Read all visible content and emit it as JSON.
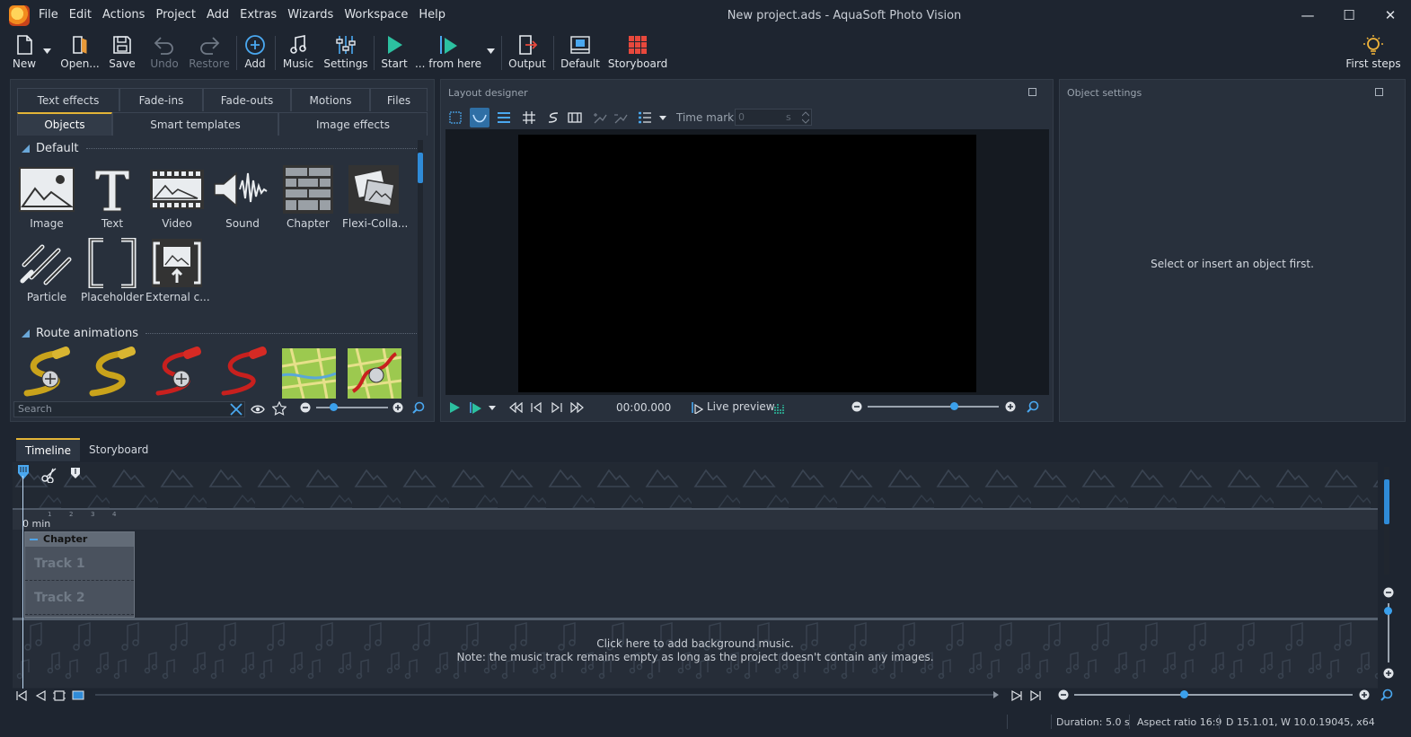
{
  "window": {
    "title": "New project.ads - AquaSoft Photo Vision",
    "minimize": "—",
    "maximize": "☐",
    "close": "✕"
  },
  "menu": [
    "File",
    "Edit",
    "Actions",
    "Project",
    "Add",
    "Extras",
    "Wizards",
    "Workspace",
    "Help"
  ],
  "toolbar": {
    "new": "New",
    "open": "Open...",
    "save": "Save",
    "undo": "Undo",
    "restore": "Restore",
    "add": "Add",
    "music": "Music",
    "settings": "Settings",
    "start": "Start",
    "from_here": "... from here",
    "output": "Output",
    "default": "Default",
    "storyboard": "Storyboard",
    "first_steps": "First steps"
  },
  "toolbox": {
    "tabs_row1": [
      "Text effects",
      "Fade-ins",
      "Fade-outs",
      "Motions",
      "Files"
    ],
    "tabs_row2": [
      "Objects",
      "Smart templates",
      "Image effects"
    ],
    "section_default": "Default",
    "objects": [
      "Image",
      "Text",
      "Video",
      "Sound",
      "Chapter",
      "Flexi-Colla...",
      "Particle",
      "Placeholder",
      "External c..."
    ],
    "section_routes": "Route animations",
    "search_placeholder": "Search"
  },
  "layout_designer": {
    "title": "Layout designer",
    "time_mark_label": "Time mark:",
    "time_mark_value": "0",
    "time_mark_unit": "s",
    "time_display": "00:00.000",
    "live_preview": "Live preview"
  },
  "object_settings": {
    "title": "Object settings",
    "empty_message": "Select or insert an object first."
  },
  "timeline": {
    "tabs": [
      "Timeline",
      "Storyboard"
    ],
    "ruler_label": "0 min",
    "ruler_ticks": [
      "1",
      "2",
      "3",
      "4"
    ],
    "chapter_label": "Chapter",
    "tracks": [
      "Track 1",
      "Track 2"
    ],
    "music_line1": "Click here to add background music.",
    "music_line2": "Note: the music track remains empty as long as the project doesn't contain any images."
  },
  "status": {
    "duration": "Duration: 5.0 s",
    "aspect": "Aspect ratio 16:9",
    "version": "D 15.1.01, W 10.0.19045, x64"
  },
  "colors": {
    "accent": "#2f8bd8",
    "tab_highlight": "#e3b437",
    "start_green": "#2cc0a0"
  }
}
